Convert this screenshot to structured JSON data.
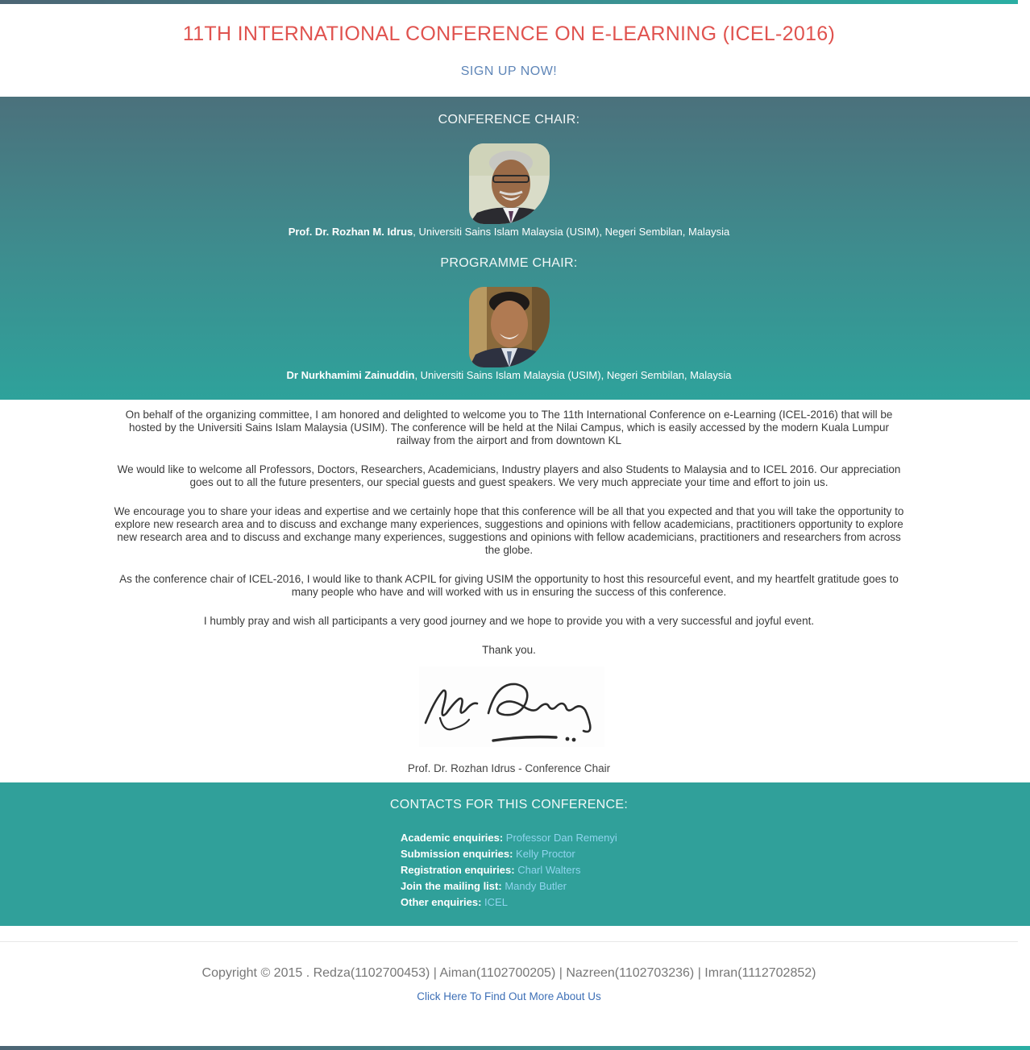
{
  "header": {
    "title": "11TH INTERNATIONAL CONFERENCE ON E-LEARNING (ICEL-2016)",
    "signup_label": "SIGN UP NOW!"
  },
  "chairs": {
    "conference": {
      "heading": "CONFERENCE CHAIR:",
      "name": "Prof. Dr. Rozhan M. Idrus",
      "affiliation": ", Universiti Sains Islam Malaysia (USIM), Negeri Sembilan, Malaysia"
    },
    "programme": {
      "heading": "PROGRAMME CHAIR:",
      "name": "Dr Nurkhamimi Zainuddin",
      "affiliation": ", Universiti Sains Islam Malaysia (USIM), Negeri Sembilan, Malaysia"
    }
  },
  "welcome": {
    "paragraphs": [
      "On behalf of the organizing committee, I am honored and delighted to welcome you to The 11th International Conference on e-Learning (ICEL-2016) that will be hosted by the Universiti Sains Islam Malaysia (USIM). The conference will be held at the Nilai Campus, which is easily accessed by the modern Kuala Lumpur railway from the airport and from downtown KL",
      "We would like to welcome all Professors, Doctors, Researchers, Academicians, Industry players and also Students to Malaysia and to ICEL 2016. Our appreciation goes out to all the future presenters, our special guests and guest speakers. We very much appreciate your time and effort to join us.",
      "We encourage you to share your ideas and expertise and we certainly hope that this conference will be all that you expected and that you will take the opportunity to explore new research area and to discuss and exchange many experiences, suggestions and opinions with fellow academicians, practitioners opportunity to explore new research area and to discuss and exchange many experiences, suggestions and opinions with fellow academicians, practitioners and researchers from across the globe.",
      "As the conference chair of ICEL-2016, I would like to thank ACPIL for giving USIM the opportunity to host this resourceful event, and my heartfelt gratitude goes to many people who have and will worked with us in ensuring the success of this conference.",
      "I humbly pray and wish all participants a very good journey and we hope to provide you with a very successful and joyful event.",
      "Thank you."
    ],
    "signature_caption": "Prof. Dr. Rozhan Idrus - Conference Chair"
  },
  "contacts": {
    "heading": "CONTACTS FOR THIS CONFERENCE:",
    "items": [
      {
        "label": "Academic enquiries:",
        "link": "Professor Dan Remenyi"
      },
      {
        "label": "Submission enquiries:",
        "link": "Kelly Proctor"
      },
      {
        "label": "Registration enquiries:",
        "link": "Charl Walters"
      },
      {
        "label": "Join the mailing list:",
        "link": "Mandy Butler"
      },
      {
        "label": "Other enquiries:",
        "link": "ICEL"
      }
    ]
  },
  "footer": {
    "copyright": "Copyright © 2015 . Redza(1102700453) | Aiman(1102700205) | Nazreen(1102703236) | Imran(1112702852)",
    "about_link": "Click Here To Find Out More About Us"
  },
  "colors": {
    "title": "#e0534f",
    "link": "#5f86b8",
    "teal_section": "#30a09a",
    "contact_link": "#8fd4ef"
  }
}
